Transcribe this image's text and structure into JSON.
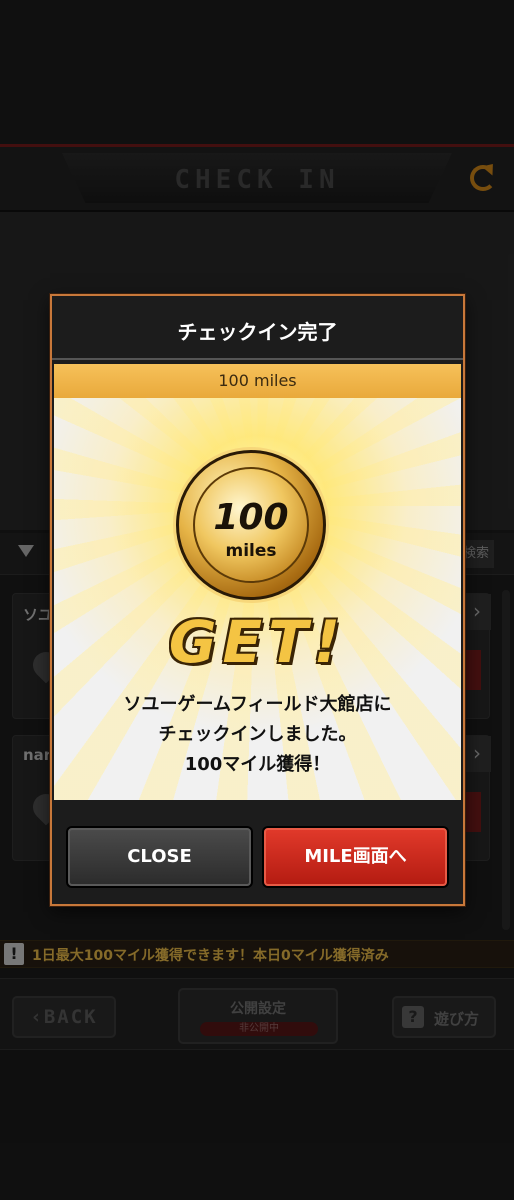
{
  "header": {
    "title": "CHECK IN",
    "refresh_icon": "refresh-icon"
  },
  "list": {
    "search_label": "検索",
    "stores": [
      {
        "name": "ソユ"
      },
      {
        "name": "nar"
      }
    ]
  },
  "notice": {
    "icon": "!",
    "text": "1日最大100マイル獲得できます！本日0マイル獲得済み"
  },
  "bottom": {
    "back_label": "BACK",
    "public_label": "公開設定",
    "public_status": "非公開中",
    "howto_icon": "?",
    "howto_label": "遊び方"
  },
  "modal": {
    "title": "チェックイン完了",
    "reward_label": "100 miles",
    "coin_value": "100",
    "coin_unit": "miles",
    "get_text": "GET!",
    "message_line1": "ソユーゲームフィールド大館店に",
    "message_line2": "チェックインしました。",
    "message_line3": "100マイル獲得！",
    "close_label": "CLOSE",
    "mile_label": "MILE画面へ"
  }
}
